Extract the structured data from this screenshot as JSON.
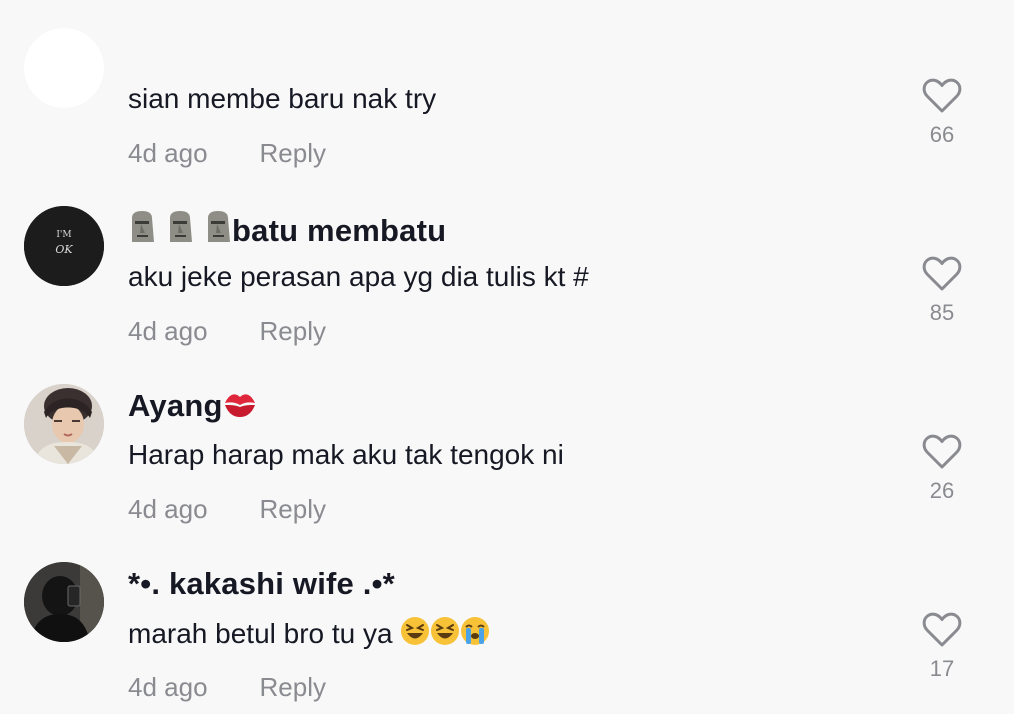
{
  "comments": [
    {
      "username": "",
      "text": "sian membe baru nak try",
      "time": "4d ago",
      "reply": "Reply",
      "likes": "66",
      "avatar": "blank-avatar"
    },
    {
      "username": "batu membatu",
      "username_emoji": "moai-icon x3",
      "text": "aku jeke perasan apa yg dia tulis kt #",
      "time": "4d ago",
      "reply": "Reply",
      "likes": "85",
      "avatar": "im-ok-avatar",
      "avatar_text_1": "I'M",
      "avatar_text_2": "OK"
    },
    {
      "username": "Ayang",
      "username_emoji": "kiss-mark-icon",
      "text": "Harap harap mak aku tak tengok ni",
      "time": "4d ago",
      "reply": "Reply",
      "likes": "26",
      "avatar": "person-photo-avatar"
    },
    {
      "username": "*•. kakashi wife .•*",
      "text": "marah betul bro tu ya",
      "text_emoji": "laughing-icon x2, crying-icon",
      "time": "4d ago",
      "reply": "Reply",
      "likes": "17",
      "avatar": "dark-photo-avatar"
    }
  ],
  "colors": {
    "background": "#f8f8f8",
    "text": "#161823",
    "muted": "#8a8b91"
  }
}
